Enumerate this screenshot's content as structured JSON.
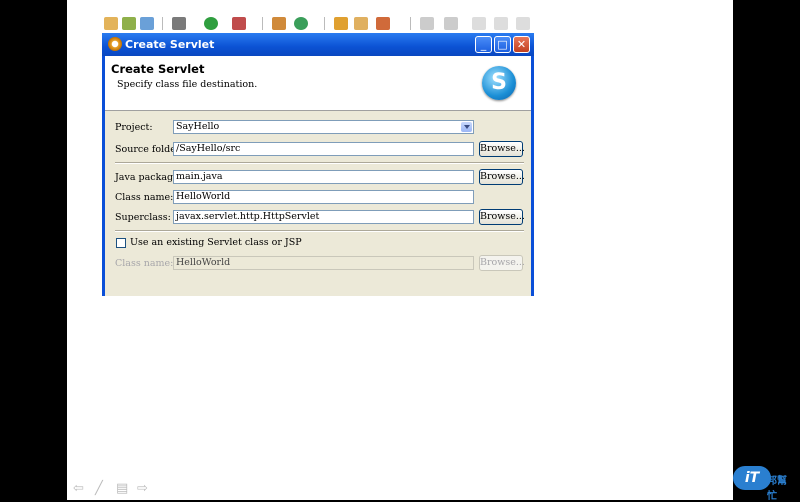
{
  "dialog": {
    "title": "Create Servlet",
    "heading": "Create Servlet",
    "description": "Specify class file destination.",
    "logo_letter": "S"
  },
  "window_buttons": {
    "minimize": "_",
    "maximize": "□",
    "close": "✕"
  },
  "form": {
    "project": {
      "label": "Project:",
      "value": "SayHello"
    },
    "source_folder": {
      "label": "Source folder:",
      "value": "/SayHello/src",
      "button": "Browse..."
    },
    "java_package": {
      "label": "Java package:",
      "value": "main.java",
      "button": "Browse..."
    },
    "class_name": {
      "label": "Class name:",
      "value": "HelloWorld"
    },
    "superclass": {
      "label": "Superclass:",
      "value": "javax.servlet.http.HttpServlet",
      "button": "Browse..."
    },
    "use_existing": {
      "label": "Use an existing Servlet class or JSP",
      "checked": false
    },
    "existing_class_name": {
      "label": "Class name:",
      "value": "HelloWorld",
      "button": "Browse...",
      "enabled": false
    }
  },
  "slide_nav": {
    "prev": "⇦",
    "pen": "╱",
    "menu": "▤",
    "next": "⇨"
  },
  "watermark": {
    "logo": "iT",
    "text": "邦幫忙"
  }
}
